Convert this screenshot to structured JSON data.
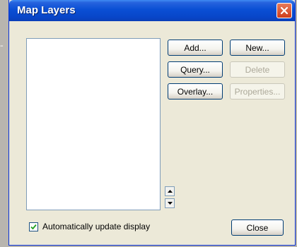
{
  "window": {
    "title": "Map Layers"
  },
  "buttons": {
    "add": "Add...",
    "new": "New...",
    "query": "Query...",
    "delete": "Delete",
    "overlay": "Overlay...",
    "properties": "Properties...",
    "close": "Close"
  },
  "layers_list": {
    "items": []
  },
  "options": {
    "auto_update_label": "Automatically update display",
    "auto_update_checked": true
  },
  "icons": {
    "close": "close-icon",
    "up": "arrow-up-icon",
    "down": "arrow-down-icon",
    "check": "checkmark-icon"
  }
}
